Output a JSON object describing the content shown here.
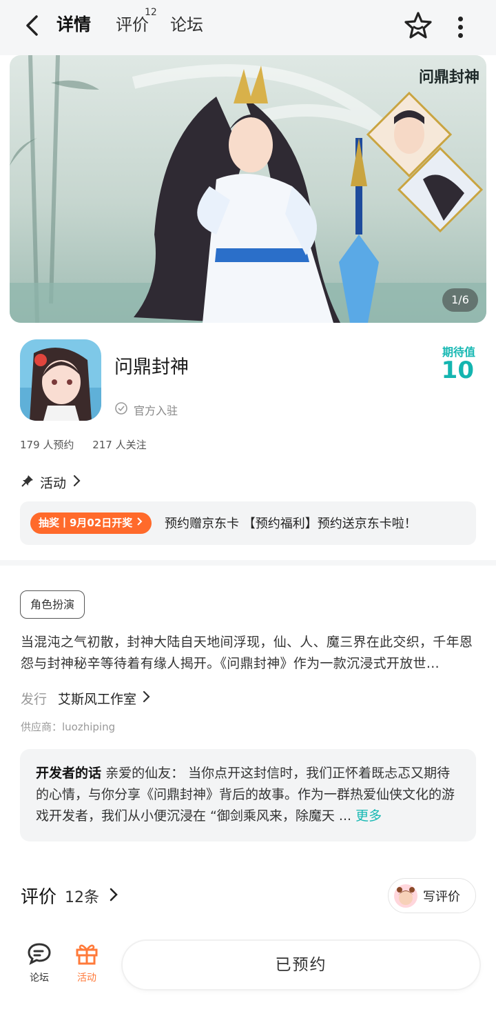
{
  "header": {
    "tabs": [
      {
        "label": "详情",
        "active": true
      },
      {
        "label": "评价",
        "badge": "12"
      },
      {
        "label": "论坛"
      }
    ]
  },
  "banner": {
    "logo_text": "问鼎封神",
    "page_indicator": "1/6"
  },
  "game": {
    "name": "问鼎封神",
    "official_label": "官方入驻",
    "expect_label": "期待值",
    "expect_value": "10",
    "reservations": "179 人预约",
    "followers": "217 人关注"
  },
  "activity": {
    "title": "活动",
    "badge": "抽奖丨9月02日开奖",
    "text": "预约赠京东卡 【预约福利】预约送京东卡啦！"
  },
  "details": {
    "genre": "角色扮演",
    "description": "当混沌之气初散，封神大陆自天地间浮现，仙、人、魔三界在此交织，千年恩怨与封神秘辛等待着有缘人揭开。《问鼎封神》作为一款沉浸式开放世…",
    "publisher_label": "发行",
    "publisher": "艾斯风工作室",
    "supplier": "供应商：luozhiping"
  },
  "developer_note": {
    "title": "开发者的话",
    "text": "亲爱的仙友： 当你点开这封信时，我们正怀着既忐忑又期待的心情，与你分享《问鼎封神》背后的故事。作为一群热爱仙侠文化的游戏开发者，我们从小便沉浸在 “御剑乘风来，除魔天 ...",
    "more": "更多"
  },
  "reviews": {
    "title": "评价",
    "count": "12条",
    "write_label": "写评价"
  },
  "bottom_bar": {
    "forum_label": "论坛",
    "activity_label": "活动",
    "reserve_label": "已预约"
  },
  "colors": {
    "accent": "#17b8b3",
    "orange": "#ff6a2b"
  }
}
